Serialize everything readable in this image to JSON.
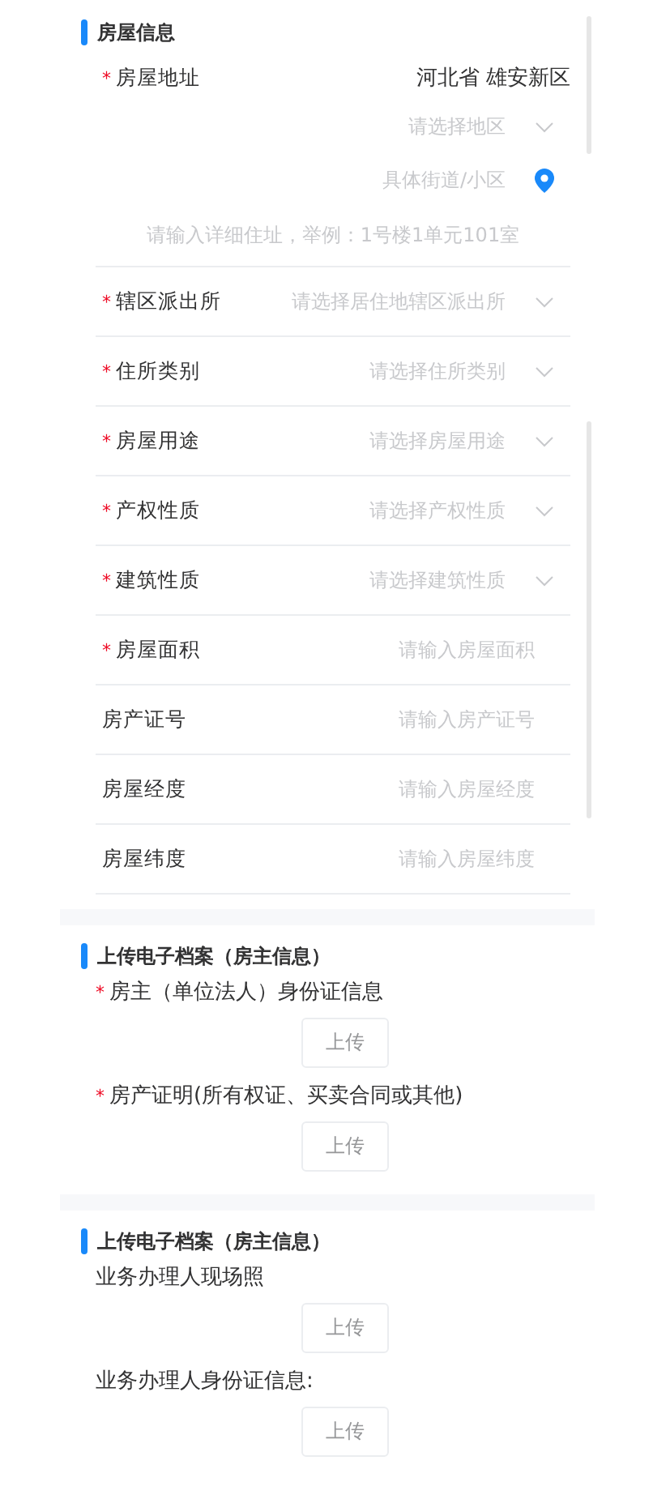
{
  "required_mark": "*",
  "house_info": {
    "title": "房屋信息",
    "address": {
      "label": "房屋地址",
      "required": true,
      "value": "河北省 雄安新区",
      "region_placeholder": "请选择地区",
      "street_placeholder": "具体街道/小区",
      "detail_placeholder": "请输入详细住址，举例：1号楼1单元101室"
    },
    "rows": [
      {
        "label": "辖区派出所",
        "required": true,
        "placeholder": "请选择居住地辖区派出所",
        "kind": "select"
      },
      {
        "label": "住所类别",
        "required": true,
        "placeholder": "请选择住所类别",
        "kind": "select"
      },
      {
        "label": "房屋用途",
        "required": true,
        "placeholder": "请选择房屋用途",
        "kind": "select"
      },
      {
        "label": "产权性质",
        "required": true,
        "placeholder": "请选择产权性质",
        "kind": "select"
      },
      {
        "label": "建筑性质",
        "required": true,
        "placeholder": "请选择建筑性质",
        "kind": "select"
      },
      {
        "label": "房屋面积",
        "required": true,
        "placeholder": "请输入房屋面积",
        "kind": "input"
      },
      {
        "label": "房产证号",
        "required": false,
        "placeholder": "请输入房产证号",
        "kind": "input"
      },
      {
        "label": "房屋经度",
        "required": false,
        "placeholder": "请输入房屋经度",
        "kind": "input"
      },
      {
        "label": "房屋纬度",
        "required": false,
        "placeholder": "请输入房屋纬度",
        "kind": "input"
      }
    ]
  },
  "upload_sections": [
    {
      "title": "上传电子档案（房主信息）",
      "items": [
        {
          "label": "房主（单位法人）身份证信息",
          "required": true,
          "button": "上传"
        },
        {
          "label": "房产证明(所有权证、买卖合同或其他)",
          "required": true,
          "button": "上传"
        }
      ]
    },
    {
      "title": "上传电子档案（房主信息）",
      "items": [
        {
          "label": "业务办理人现场照",
          "required": false,
          "button": "上传"
        },
        {
          "label": "业务办理人身份证信息:",
          "required": false,
          "button": "上传"
        }
      ]
    }
  ]
}
